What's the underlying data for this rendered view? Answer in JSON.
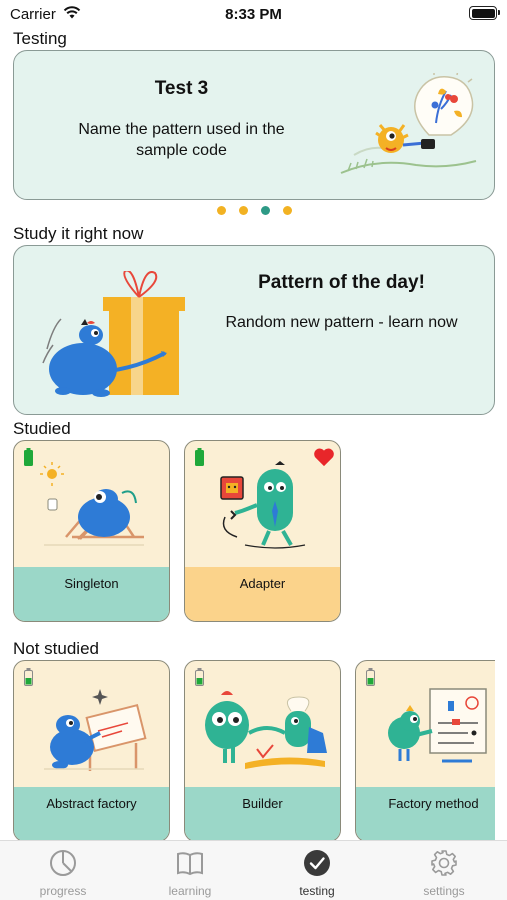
{
  "status_bar": {
    "carrier": "Carrier",
    "time": "8:33 PM"
  },
  "sections": {
    "testing": "Testing",
    "study_now": "Study it right now",
    "studied": "Studied",
    "not_studied": "Not studied"
  },
  "test_card": {
    "title": "Test 3",
    "description": "Name the pattern used in the sample code",
    "page_count": 4,
    "active_page": 3
  },
  "pattern_of_day": {
    "title": "Pattern of the day!",
    "description": "Random new pattern - learn now"
  },
  "studied": [
    {
      "label": "Singleton",
      "favorite": false,
      "bar_color": "#9bd7c8"
    },
    {
      "label": "Adapter",
      "favorite": true,
      "bar_color": "#fbd38b"
    }
  ],
  "not_studied": [
    {
      "label": "Abstract factory"
    },
    {
      "label": "Builder"
    },
    {
      "label": "Factory method"
    }
  ],
  "tabbar": [
    {
      "label": "progress",
      "icon": "progress-icon",
      "active": false
    },
    {
      "label": "learning",
      "icon": "book-icon",
      "active": false
    },
    {
      "label": "testing",
      "icon": "checkmark-circle-icon",
      "active": true
    },
    {
      "label": "settings",
      "icon": "gear-icon",
      "active": false
    }
  ],
  "colors": {
    "card_mint": "#e4f3ee",
    "tile_cream": "#fbefd4",
    "bar_teal": "#9bd7c8",
    "bar_orange": "#fbd38b",
    "dot_yellow": "#f2b223",
    "dot_active": "#2e9a86",
    "battery_green": "#1fa83a",
    "heart_red": "#e8262a"
  }
}
